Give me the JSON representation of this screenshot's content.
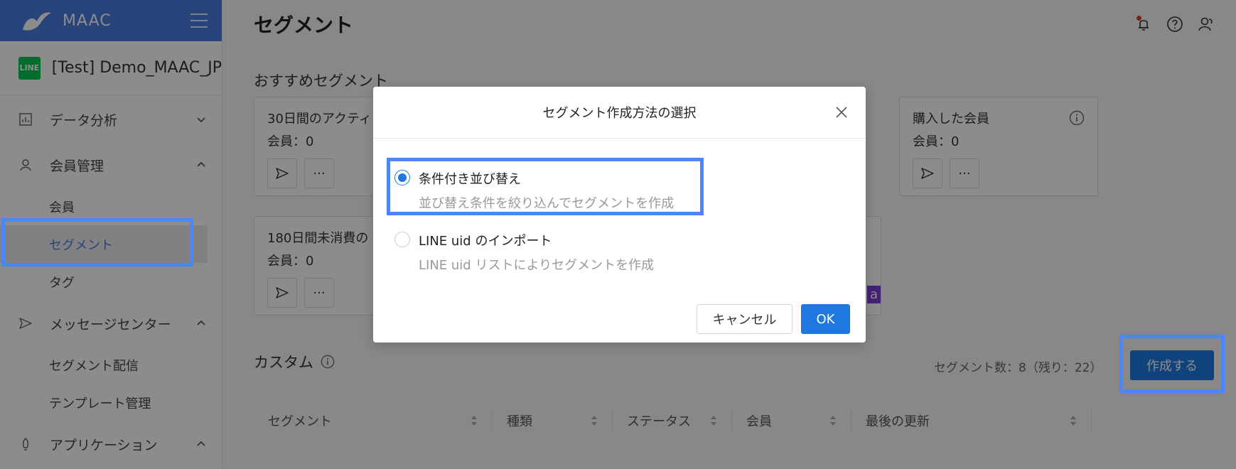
{
  "app": {
    "logo_text": "MAAC",
    "account_name": "[Test] Demo_MAAC_JP",
    "account_badge": "LINE"
  },
  "sidebar": {
    "groups": [
      {
        "label": "データ分析",
        "expanded": false
      },
      {
        "label": "会員管理",
        "expanded": true,
        "items": [
          "会員",
          "セグメント",
          "タグ"
        ]
      },
      {
        "label": "メッセージセンター",
        "expanded": true,
        "items": [
          "セグメント配信",
          "テンプレート管理"
        ]
      },
      {
        "label": "アプリケーション",
        "expanded": true
      }
    ],
    "active_item": "セグメント"
  },
  "header": {
    "title": "セグメント"
  },
  "recommended": {
    "title": "おすすめセグメント",
    "cards": [
      {
        "title": "30日間のアクティ",
        "count": "会員：0"
      },
      {
        "title": "購入した会員",
        "count": "会員：0"
      },
      {
        "title": "180日間未消費の",
        "count": "会員：0"
      }
    ],
    "tag_fragment": "a",
    "more_label": "···"
  },
  "custom": {
    "title": "カスタム",
    "segment_count": "セグメント数：8（残り：22）",
    "create_button": "作成する",
    "columns": [
      "セグメント",
      "種類",
      "ステータス",
      "会員",
      "最後の更新"
    ]
  },
  "dialog": {
    "title": "セグメント作成方法の選択",
    "options": [
      {
        "title": "条件付き並び替え",
        "desc": "並び替え条件を絞り込んでセグメントを作成",
        "checked": true
      },
      {
        "title": "LINE uid のインポート",
        "desc": "LINE uid リストによりセグメントを作成",
        "checked": false
      }
    ],
    "cancel_label": "キャンセル",
    "ok_label": "OK"
  },
  "colors": {
    "brand": "#4a7cde",
    "primary": "#1e78e0",
    "highlight": "#4a86ff",
    "line_green": "#06c755",
    "tag_purple": "#7b3fd6"
  }
}
